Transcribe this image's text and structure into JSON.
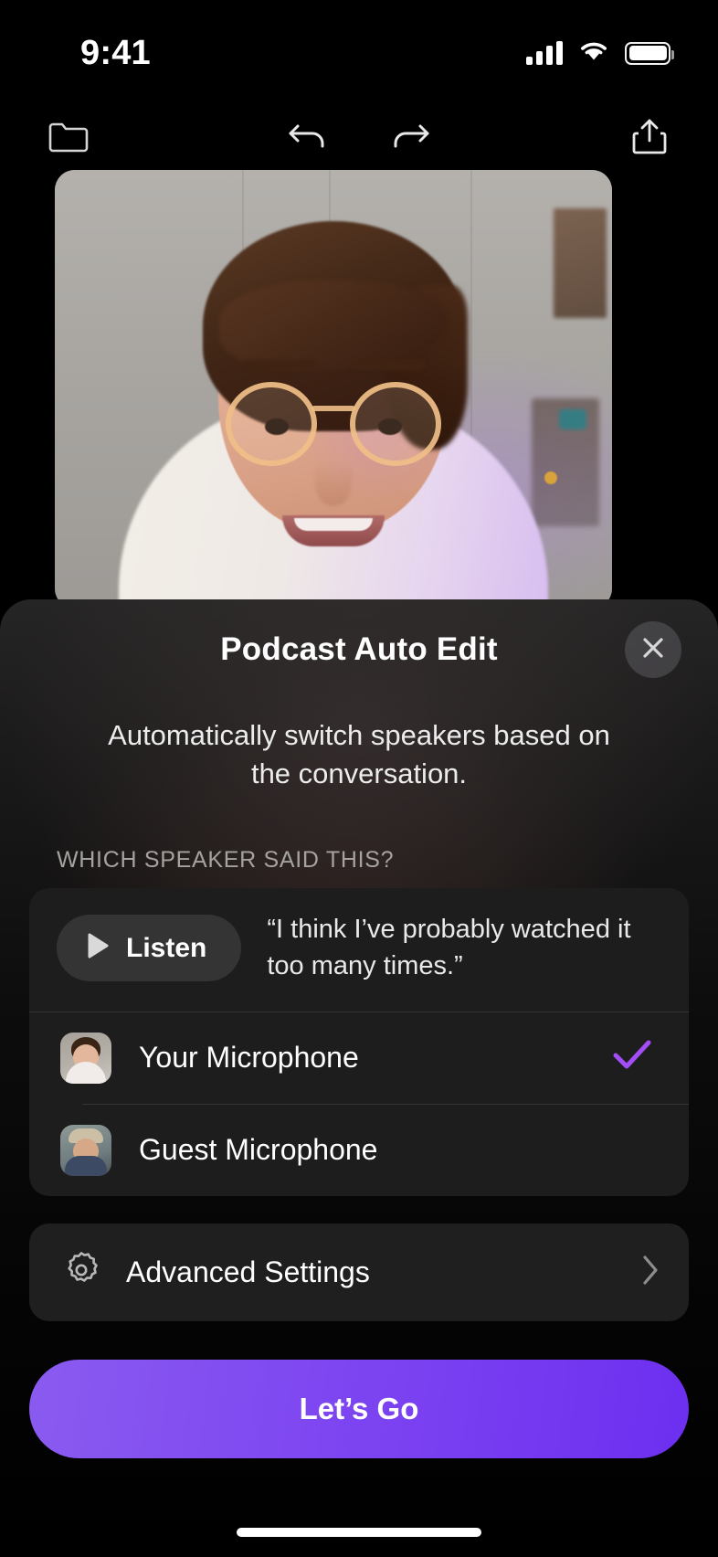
{
  "status_bar": {
    "time": "9:41",
    "cellular_icon": "cellular-bars-icon",
    "wifi_icon": "wifi-icon",
    "battery_icon": "battery-full-icon"
  },
  "toolbar": {
    "folder_icon": "folder-icon",
    "undo_icon": "undo-arrow-icon",
    "redo_icon": "redo-arrow-icon",
    "share_icon": "share-icon"
  },
  "preview": {
    "alt": "video-preview-person"
  },
  "sheet": {
    "title": "Podcast Auto Edit",
    "close_icon": "close-x-icon",
    "subtitle": "Automatically switch speakers based on the conversation.",
    "section_label": "WHICH SPEAKER SAID THIS?",
    "listen": {
      "label": "Listen",
      "icon": "play-icon"
    },
    "quote": "“I think I’ve probably watched it too many times.”",
    "speakers": [
      {
        "name": "Your Microphone",
        "avatar": "avatar-your-microphone",
        "selected": true,
        "check_icon": "checkmark-icon"
      },
      {
        "name": "Guest Microphone",
        "avatar": "avatar-guest-microphone",
        "selected": false,
        "check_icon": ""
      }
    ],
    "advanced_settings": {
      "label": "Advanced Settings",
      "icon": "gear-icon",
      "chevron": "chevron-right-icon"
    },
    "cta": {
      "label": "Let’s Go"
    }
  },
  "colors": {
    "accent_purple": "#7D45F1",
    "checkmark_purple": "#A24DF5",
    "sheet_bg": "#141414",
    "card_bg": "#1D1D1D",
    "listen_bg": "#343434"
  },
  "home_indicator": "home-indicator"
}
